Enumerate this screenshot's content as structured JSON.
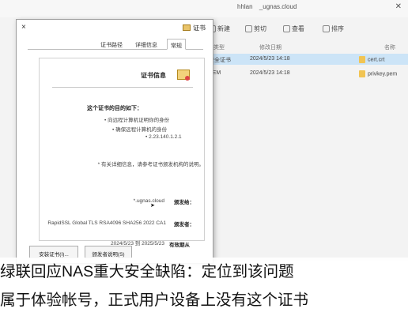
{
  "explorer": {
    "path": [
      "hhlan",
      "_ugnas.cloud"
    ],
    "toolbar": [
      "新建",
      "剪切",
      "查看",
      "排序"
    ],
    "headers": {
      "name": "名称",
      "date": "修改日期",
      "type": "类型"
    },
    "rows": [
      {
        "name": "cert.crt",
        "date": "2024/5/23 14:18",
        "type": "安全证书",
        "selected": true
      },
      {
        "name": "privkey.pem",
        "date": "2024/5/23 14:18",
        "type": "PEM"
      }
    ]
  },
  "dialog": {
    "title": "证书",
    "close": "×",
    "tabs": [
      "常规",
      "详细信息",
      "证书路径"
    ],
    "info_title": "证书信息",
    "purpose_head": "这个证书的目的如下：",
    "purposes": [
      "• 向远程计算机证明你的身份",
      "• 确保远程计算机的身份",
      "• 2.23.140.1.2.1"
    ],
    "note": "* 有关详细信息，请参考证书颁发机构的说明。",
    "issued_to_label": "颁发给：",
    "issued_to_value": "*.ugnas.cloud",
    "issued_by_label": "颁发者：",
    "issued_by_value": "RapidSSL Global TLS RSA4096 SHA256 2022 CA1",
    "valid_label": "有效期从",
    "valid_value": "2024/5/23 到 2025/5/23",
    "install_button": "安装证书(I)...",
    "issuer_button": "颁发者说明(S)"
  },
  "caption": {
    "line1": "绿联回应NAS重大安全缺陷：定位到该问题",
    "line2": "属于体验帐号，正式用户设备上没有这个证书"
  },
  "colors": {
    "selection": "#cce4f7",
    "cert_icon": "#f2d27b"
  }
}
